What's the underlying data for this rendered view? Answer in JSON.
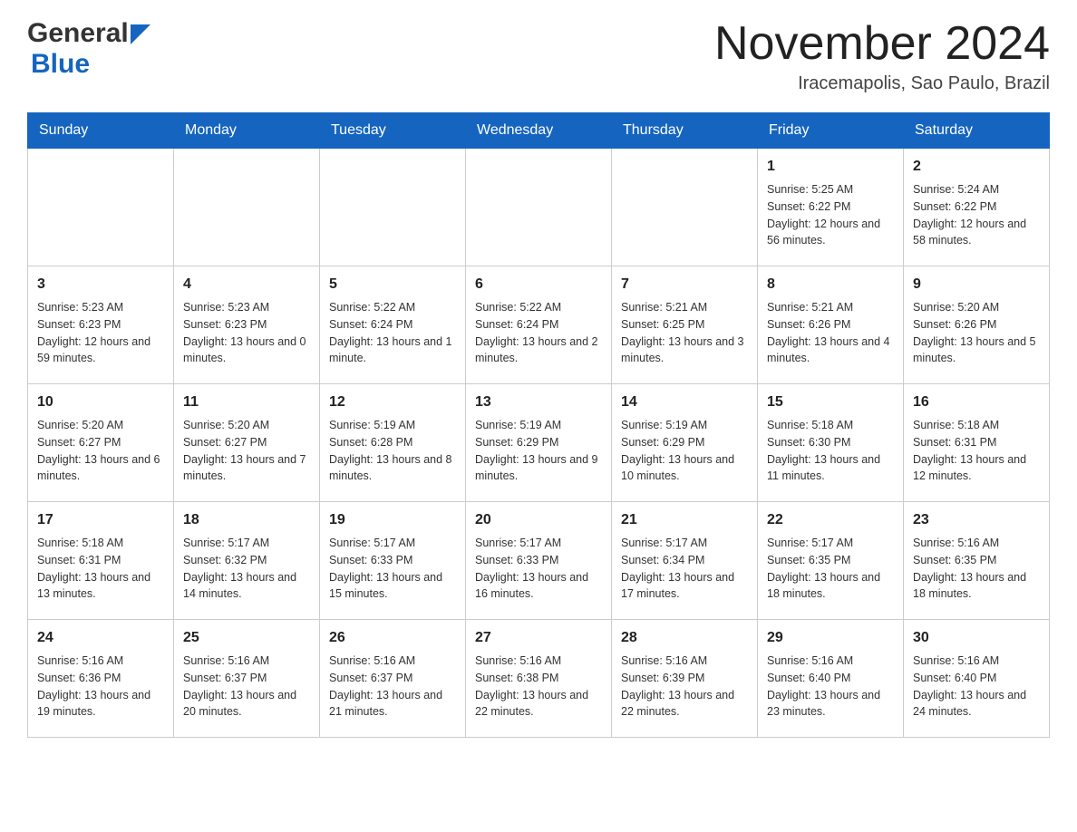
{
  "logo": {
    "general": "General",
    "blue": "Blue",
    "has_arrow": true
  },
  "header": {
    "title": "November 2024",
    "location": "Iracemapolis, Sao Paulo, Brazil"
  },
  "weekdays": [
    "Sunday",
    "Monday",
    "Tuesday",
    "Wednesday",
    "Thursday",
    "Friday",
    "Saturday"
  ],
  "weeks": [
    [
      {
        "day": "",
        "info": ""
      },
      {
        "day": "",
        "info": ""
      },
      {
        "day": "",
        "info": ""
      },
      {
        "day": "",
        "info": ""
      },
      {
        "day": "",
        "info": ""
      },
      {
        "day": "1",
        "info": "Sunrise: 5:25 AM\nSunset: 6:22 PM\nDaylight: 12 hours and 56 minutes."
      },
      {
        "day": "2",
        "info": "Sunrise: 5:24 AM\nSunset: 6:22 PM\nDaylight: 12 hours and 58 minutes."
      }
    ],
    [
      {
        "day": "3",
        "info": "Sunrise: 5:23 AM\nSunset: 6:23 PM\nDaylight: 12 hours and 59 minutes."
      },
      {
        "day": "4",
        "info": "Sunrise: 5:23 AM\nSunset: 6:23 PM\nDaylight: 13 hours and 0 minutes."
      },
      {
        "day": "5",
        "info": "Sunrise: 5:22 AM\nSunset: 6:24 PM\nDaylight: 13 hours and 1 minute."
      },
      {
        "day": "6",
        "info": "Sunrise: 5:22 AM\nSunset: 6:24 PM\nDaylight: 13 hours and 2 minutes."
      },
      {
        "day": "7",
        "info": "Sunrise: 5:21 AM\nSunset: 6:25 PM\nDaylight: 13 hours and 3 minutes."
      },
      {
        "day": "8",
        "info": "Sunrise: 5:21 AM\nSunset: 6:26 PM\nDaylight: 13 hours and 4 minutes."
      },
      {
        "day": "9",
        "info": "Sunrise: 5:20 AM\nSunset: 6:26 PM\nDaylight: 13 hours and 5 minutes."
      }
    ],
    [
      {
        "day": "10",
        "info": "Sunrise: 5:20 AM\nSunset: 6:27 PM\nDaylight: 13 hours and 6 minutes."
      },
      {
        "day": "11",
        "info": "Sunrise: 5:20 AM\nSunset: 6:27 PM\nDaylight: 13 hours and 7 minutes."
      },
      {
        "day": "12",
        "info": "Sunrise: 5:19 AM\nSunset: 6:28 PM\nDaylight: 13 hours and 8 minutes."
      },
      {
        "day": "13",
        "info": "Sunrise: 5:19 AM\nSunset: 6:29 PM\nDaylight: 13 hours and 9 minutes."
      },
      {
        "day": "14",
        "info": "Sunrise: 5:19 AM\nSunset: 6:29 PM\nDaylight: 13 hours and 10 minutes."
      },
      {
        "day": "15",
        "info": "Sunrise: 5:18 AM\nSunset: 6:30 PM\nDaylight: 13 hours and 11 minutes."
      },
      {
        "day": "16",
        "info": "Sunrise: 5:18 AM\nSunset: 6:31 PM\nDaylight: 13 hours and 12 minutes."
      }
    ],
    [
      {
        "day": "17",
        "info": "Sunrise: 5:18 AM\nSunset: 6:31 PM\nDaylight: 13 hours and 13 minutes."
      },
      {
        "day": "18",
        "info": "Sunrise: 5:17 AM\nSunset: 6:32 PM\nDaylight: 13 hours and 14 minutes."
      },
      {
        "day": "19",
        "info": "Sunrise: 5:17 AM\nSunset: 6:33 PM\nDaylight: 13 hours and 15 minutes."
      },
      {
        "day": "20",
        "info": "Sunrise: 5:17 AM\nSunset: 6:33 PM\nDaylight: 13 hours and 16 minutes."
      },
      {
        "day": "21",
        "info": "Sunrise: 5:17 AM\nSunset: 6:34 PM\nDaylight: 13 hours and 17 minutes."
      },
      {
        "day": "22",
        "info": "Sunrise: 5:17 AM\nSunset: 6:35 PM\nDaylight: 13 hours and 18 minutes."
      },
      {
        "day": "23",
        "info": "Sunrise: 5:16 AM\nSunset: 6:35 PM\nDaylight: 13 hours and 18 minutes."
      }
    ],
    [
      {
        "day": "24",
        "info": "Sunrise: 5:16 AM\nSunset: 6:36 PM\nDaylight: 13 hours and 19 minutes."
      },
      {
        "day": "25",
        "info": "Sunrise: 5:16 AM\nSunset: 6:37 PM\nDaylight: 13 hours and 20 minutes."
      },
      {
        "day": "26",
        "info": "Sunrise: 5:16 AM\nSunset: 6:37 PM\nDaylight: 13 hours and 21 minutes."
      },
      {
        "day": "27",
        "info": "Sunrise: 5:16 AM\nSunset: 6:38 PM\nDaylight: 13 hours and 22 minutes."
      },
      {
        "day": "28",
        "info": "Sunrise: 5:16 AM\nSunset: 6:39 PM\nDaylight: 13 hours and 22 minutes."
      },
      {
        "day": "29",
        "info": "Sunrise: 5:16 AM\nSunset: 6:40 PM\nDaylight: 13 hours and 23 minutes."
      },
      {
        "day": "30",
        "info": "Sunrise: 5:16 AM\nSunset: 6:40 PM\nDaylight: 13 hours and 24 minutes."
      }
    ]
  ]
}
